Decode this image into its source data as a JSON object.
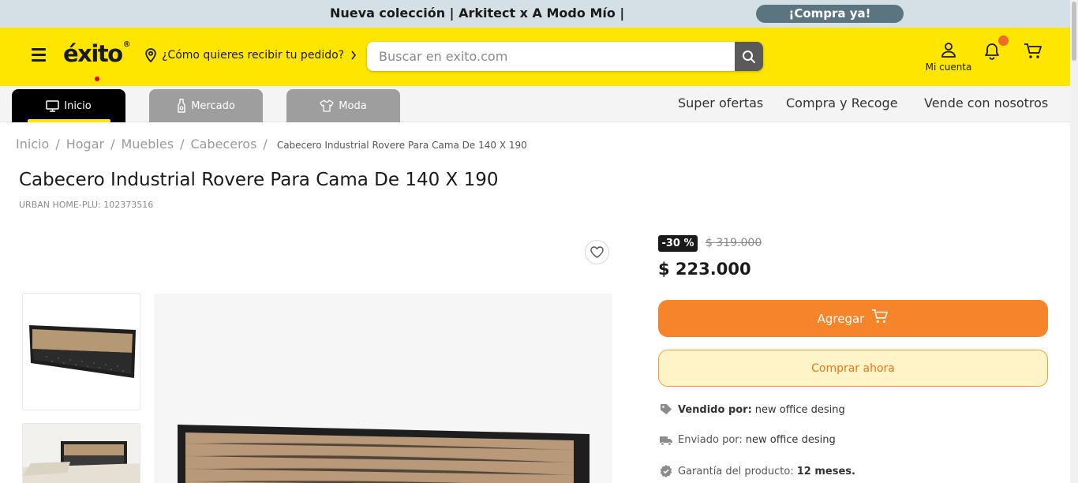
{
  "promo": {
    "text": "Nueva colección | Arkitect x A Modo Mío |",
    "cta": "¡Compra ya!"
  },
  "header": {
    "logo": "éxito",
    "logo_registered": "®",
    "delivery_prompt": "¿Cómo quieres recibir tu pedido?",
    "search_placeholder": "Buscar en exito.com",
    "account_label": "Mi cuenta"
  },
  "categories": {
    "tabs": [
      {
        "label": "Inicio",
        "icon": "monitor-icon",
        "active": true
      },
      {
        "label": "Mercado",
        "icon": "bottle-icon",
        "active": false
      },
      {
        "label": "Moda",
        "icon": "shirt-icon",
        "active": false
      }
    ],
    "links": [
      "Super ofertas",
      "Compra y Recoge",
      "Vende con nosotros"
    ]
  },
  "breadcrumb": {
    "items": [
      "Inicio",
      "Hogar",
      "Muebles",
      "Cabeceros"
    ],
    "current": "Cabecero Industrial Rovere Para Cama De 140 X 190"
  },
  "product": {
    "title": "Cabecero Industrial Rovere Para Cama De 140 X 190",
    "sku": "URBAN HOME-PLU: 102373516",
    "discount_badge": "-30 %",
    "old_price": "$ 319.000",
    "price": "$ 223.000",
    "add_button": "Agregar",
    "buy_now_button": "Comprar ahora",
    "sold_by_label": "Vendido por:",
    "sold_by_value": "new office desing",
    "shipped_by_label": "Enviado por:",
    "shipped_by_value": "new office desing",
    "warranty_label": "Garantía del producto:",
    "warranty_value": "12 meses."
  },
  "colors": {
    "brand_yellow": "#ffe600",
    "accent_orange": "#f5842a",
    "promo_bg": "#d5e0e6"
  }
}
